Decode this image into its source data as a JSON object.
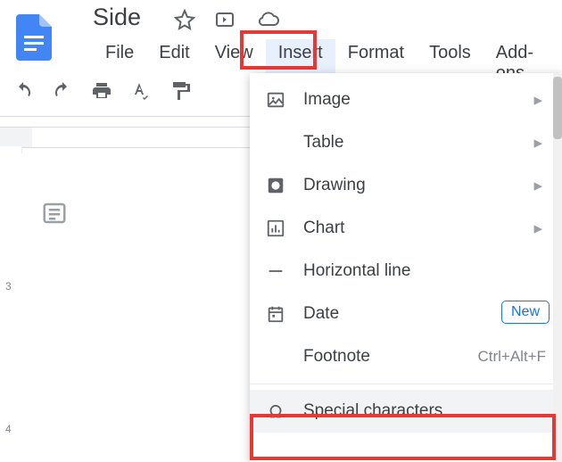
{
  "doc": {
    "title": "Side"
  },
  "menu": {
    "file": "File",
    "edit": "Edit",
    "view": "View",
    "insert": "Insert",
    "format": "Format",
    "tools": "Tools",
    "addons": "Add-ons"
  },
  "vruler": {
    "n3": "3",
    "n4": "4"
  },
  "dropdown": {
    "image": "Image",
    "table": "Table",
    "drawing": "Drawing",
    "chart": "Chart",
    "hline": "Horizontal line",
    "date": "Date",
    "date_badge": "New",
    "footnote": "Footnote",
    "footnote_shortcut": "Ctrl+Alt+F",
    "special": "Special characters"
  }
}
